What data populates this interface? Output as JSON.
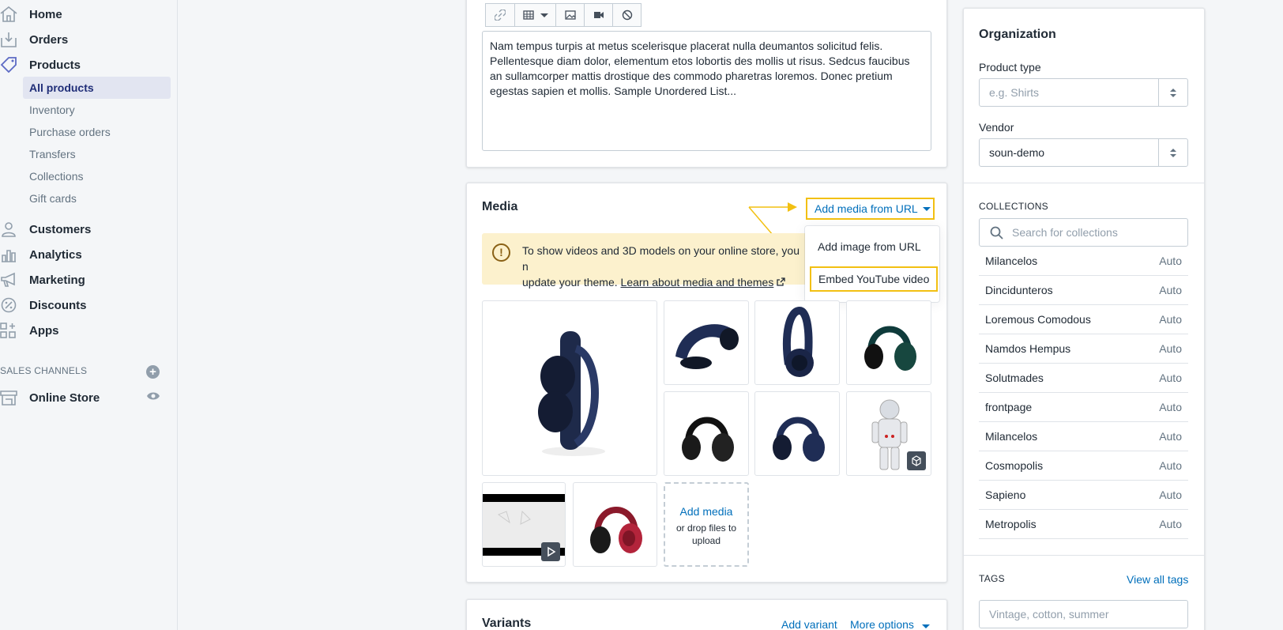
{
  "sidebar": {
    "nav": [
      {
        "label": "Home",
        "icon": "home-icon"
      },
      {
        "label": "Orders",
        "icon": "orders-icon"
      },
      {
        "label": "Products",
        "icon": "tag-icon"
      }
    ],
    "products_sub": [
      "All products",
      "Inventory",
      "Purchase orders",
      "Transfers",
      "Collections",
      "Gift cards"
    ],
    "nav2": [
      {
        "label": "Customers",
        "icon": "customers-icon"
      },
      {
        "label": "Analytics",
        "icon": "analytics-icon"
      },
      {
        "label": "Marketing",
        "icon": "marketing-icon"
      },
      {
        "label": "Discounts",
        "icon": "discounts-icon"
      },
      {
        "label": "Apps",
        "icon": "apps-icon"
      }
    ],
    "sales_channels_heading": "SALES CHANNELS",
    "add_channel": "+",
    "online_store": "Online Store"
  },
  "editor": {
    "body": "Nam tempus turpis at metus scelerisque placerat nulla deumantos solicitud felis. Pellentesque diam dolor, elementum etos lobortis des mollis ut risus. Sedcus faucibus an sullamcorper mattis drostique des commodo pharetras loremos. Donec pretium egestas sapien et mollis. Sample Unordered List..."
  },
  "media": {
    "title": "Media",
    "add_from_url": "Add media from URL",
    "banner_text": "To show videos and 3D models on your online store, you n",
    "banner_text2": "update your theme.",
    "banner_link": "Learn about media and themes",
    "dropdown": [
      "Add image from URL",
      "Embed YouTube video"
    ],
    "add_media": "Add media",
    "drop_files": "or drop files to upload"
  },
  "variants": {
    "title": "Variants",
    "add_variant": "Add variant",
    "more_options": "More options"
  },
  "organization": {
    "title": "Organization",
    "product_type_label": "Product type",
    "product_type_placeholder": "e.g. Shirts",
    "vendor_label": "Vendor",
    "vendor_value": "soun-demo",
    "collections_heading": "COLLECTIONS",
    "collections_search_placeholder": "Search for collections",
    "collections": [
      {
        "name": "Milancelos",
        "mode": "Auto"
      },
      {
        "name": "Dincidunteros",
        "mode": "Auto"
      },
      {
        "name": "Loremous Comodous",
        "mode": "Auto"
      },
      {
        "name": "Namdos Hempus",
        "mode": "Auto"
      },
      {
        "name": "Solutmades",
        "mode": "Auto"
      },
      {
        "name": "frontpage",
        "mode": "Auto"
      },
      {
        "name": "Milancelos",
        "mode": "Auto"
      },
      {
        "name": "Cosmopolis",
        "mode": "Auto"
      },
      {
        "name": "Sapieno",
        "mode": "Auto"
      },
      {
        "name": "Metropolis",
        "mode": "Auto"
      }
    ],
    "tags_heading": "TAGS",
    "view_all_tags": "View all tags",
    "tags_placeholder": "Vintage, cotton, summer"
  },
  "colors": {
    "accent": "#006fbb",
    "highlight": "#f2c012",
    "active_bg": "#e2e5f1"
  }
}
